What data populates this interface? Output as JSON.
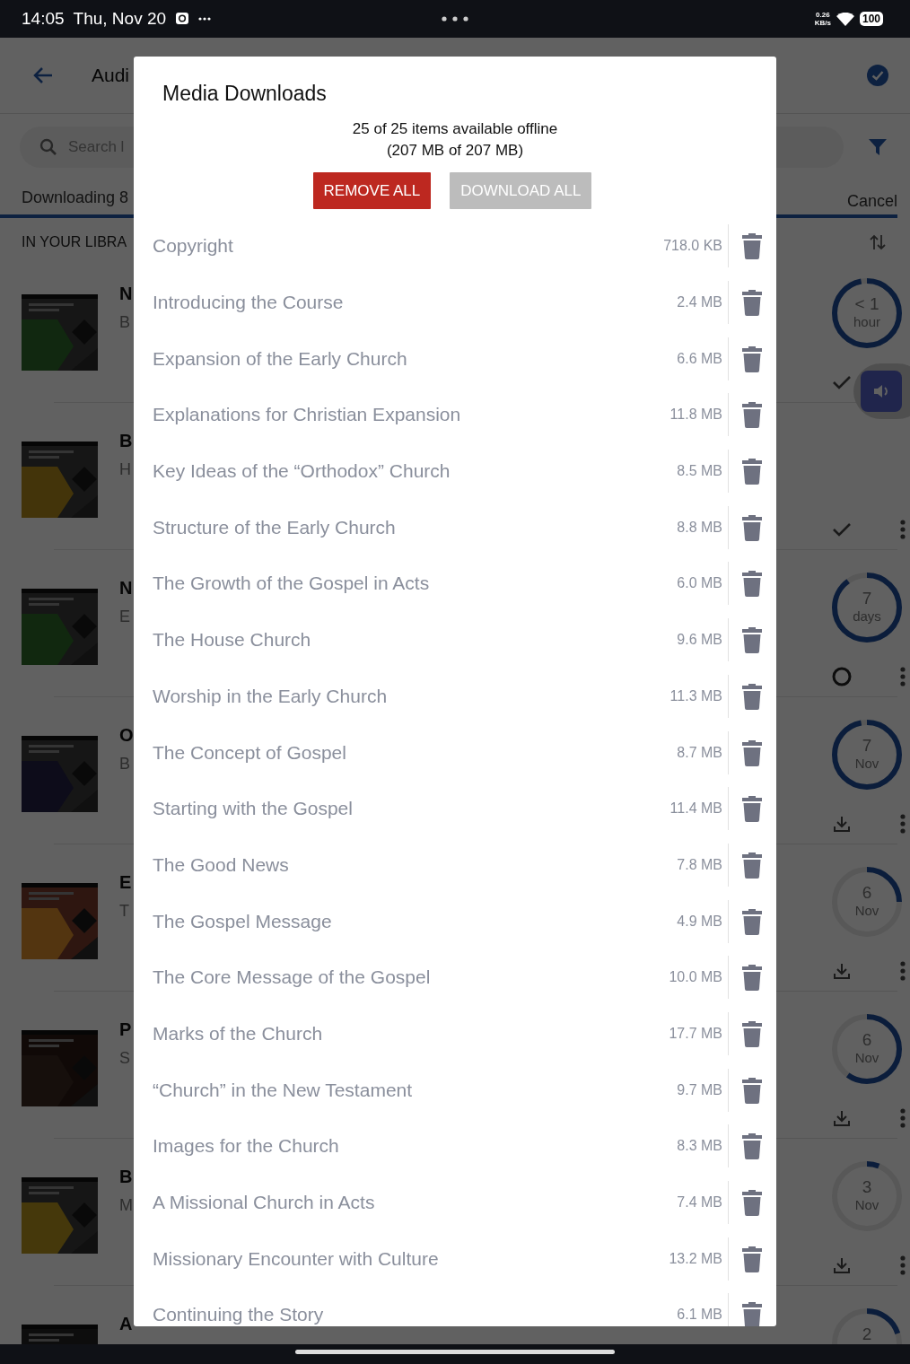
{
  "status_bar": {
    "time": "14:05",
    "date": "Thu, Nov 20",
    "speed_value": "0.26",
    "speed_unit": "KB/s",
    "battery": "100"
  },
  "header": {
    "title": "Audi"
  },
  "search": {
    "placeholder": "Search l"
  },
  "tabs": [
    {
      "label": "Downloading 8",
      "selected": true
    }
  ],
  "cancel_label": "Cancel",
  "section_label": "IN YOUR LIBRA",
  "library": [
    {
      "title": "N",
      "subtitle": "B",
      "ring": {
        "line1": "< 1",
        "line2": "hour",
        "level": 0.97
      },
      "kind": "done",
      "menu": false
    },
    {
      "title": "B",
      "subtitle": "H",
      "kind": "done",
      "menu": true
    },
    {
      "title": "N",
      "subtitle": "E",
      "ring": {
        "line1": "7",
        "line2": "days",
        "level": 0.9
      },
      "kind": "loading",
      "menu": true
    },
    {
      "title": "O",
      "subtitle": "B",
      "ring": {
        "line1": "7",
        "line2": "Nov",
        "level": 0.97
      },
      "kind": "download",
      "menu": true
    },
    {
      "title": "E",
      "subtitle": "T",
      "ring": {
        "line1": "6",
        "line2": "Nov",
        "level": 0.25
      },
      "kind": "download",
      "menu": true
    },
    {
      "title": "P",
      "subtitle": "S",
      "ring": {
        "line1": "6",
        "line2": "Nov",
        "level": 0.6
      },
      "kind": "download",
      "menu": true
    },
    {
      "title": "B",
      "subtitle": "M",
      "ring": {
        "line1": "3",
        "line2": "Nov",
        "level": 0.06
      },
      "kind": "download",
      "menu": true
    },
    {
      "title": "A",
      "ring": {
        "line1": "2",
        "level": 0.2
      }
    }
  ],
  "dialog": {
    "title": "Media Downloads",
    "summary_line1": "25 of 25 items available offline",
    "summary_line2": "(207 MB of 207 MB)",
    "remove_all": {
      "label": "REMOVE ALL",
      "disabled": false
    },
    "download_all": {
      "label": "DOWNLOAD ALL",
      "disabled": true
    },
    "items": [
      {
        "title": "Copyright",
        "size": "718.0 KB"
      },
      {
        "title": "Introducing the Course",
        "size": "2.4 MB"
      },
      {
        "title": "Expansion of the Early Church",
        "size": "6.6 MB"
      },
      {
        "title": "Explanations for Christian Expansion",
        "size": "11.8 MB"
      },
      {
        "title": "Key Ideas of the “Orthodox” Church",
        "size": "8.5 MB"
      },
      {
        "title": "Structure of the Early Church",
        "size": "8.8 MB"
      },
      {
        "title": "The Growth of the Gospel in Acts",
        "size": "6.0 MB"
      },
      {
        "title": "The House Church",
        "size": "9.6 MB"
      },
      {
        "title": "Worship in the Early Church",
        "size": "11.3 MB"
      },
      {
        "title": "The Concept of Gospel",
        "size": "8.7 MB"
      },
      {
        "title": "Starting with the Gospel",
        "size": "11.4 MB"
      },
      {
        "title": "The Good News",
        "size": "7.8 MB"
      },
      {
        "title": "The Gospel Message",
        "size": "4.9 MB"
      },
      {
        "title": "The Core Message of the Gospel",
        "size": "10.0 MB"
      },
      {
        "title": "Marks of the Church",
        "size": "17.7 MB"
      },
      {
        "title": "“Church” in the New Testament",
        "size": "9.7 MB"
      },
      {
        "title": "Images for the Church",
        "size": "8.3 MB"
      },
      {
        "title": "A Missional Church in Acts",
        "size": "7.4 MB"
      },
      {
        "title": "Missionary Encounter with Culture",
        "size": "13.2 MB"
      },
      {
        "title": "Continuing the Story",
        "size": "6.1 MB"
      }
    ]
  }
}
